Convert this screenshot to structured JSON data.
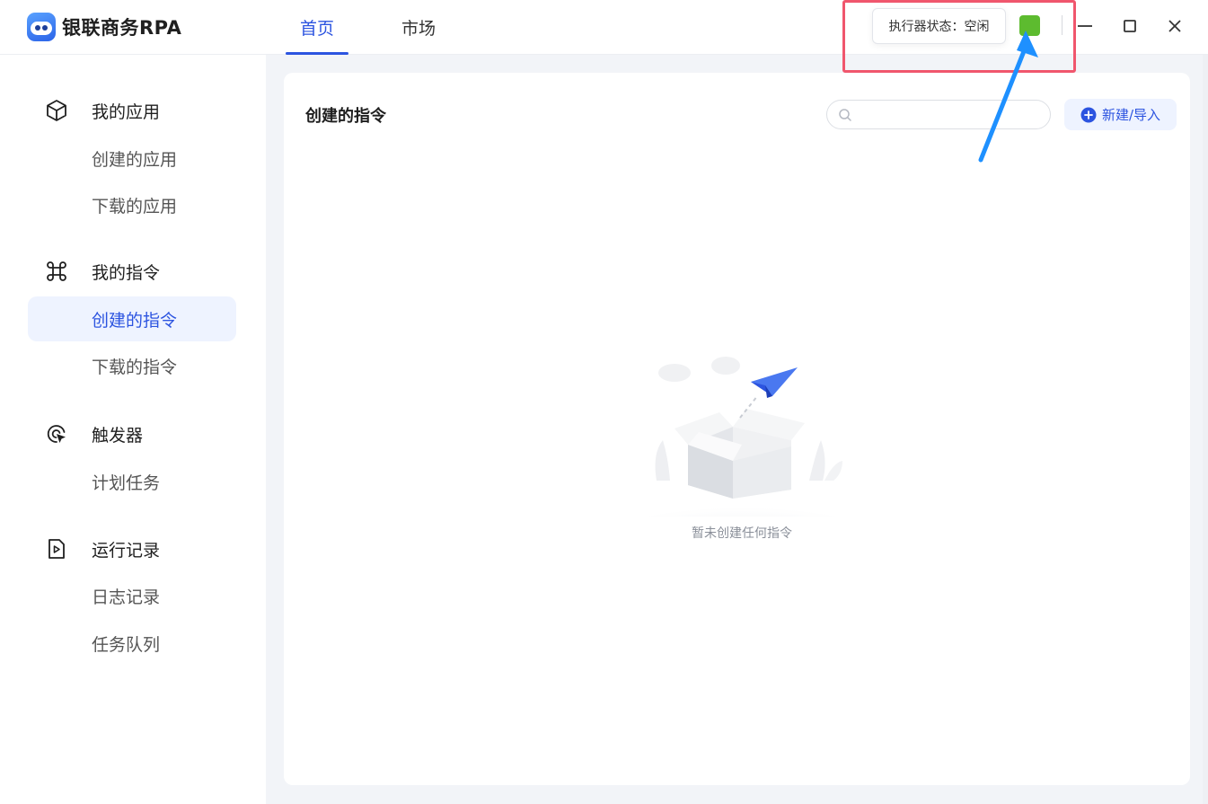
{
  "app": {
    "name": "银联商务RPA"
  },
  "nav": {
    "tabs": [
      {
        "label": "首页",
        "active": true
      },
      {
        "label": "市场",
        "active": false
      }
    ]
  },
  "executor": {
    "tooltip": "执行器状态：空闲",
    "status_color": "#5dbb2f"
  },
  "window_controls": [
    "minimize-icon",
    "maximize-icon",
    "close-icon"
  ],
  "sidebar": {
    "groups": [
      {
        "title": "我的应用",
        "icon": "cube-icon",
        "items": [
          {
            "label": "创建的应用",
            "active": false
          },
          {
            "label": "下载的应用",
            "active": false
          }
        ]
      },
      {
        "title": "我的指令",
        "icon": "command-icon",
        "items": [
          {
            "label": "创建的指令",
            "active": true
          },
          {
            "label": "下载的指令",
            "active": false
          }
        ]
      },
      {
        "title": "触发器",
        "icon": "trigger-icon",
        "items": [
          {
            "label": "计划任务",
            "active": false
          }
        ]
      },
      {
        "title": "运行记录",
        "icon": "play-file-icon",
        "items": [
          {
            "label": "日志记录",
            "active": false
          },
          {
            "label": "任务队列",
            "active": false
          }
        ]
      }
    ]
  },
  "main": {
    "title": "创建的指令",
    "search": {
      "value": "",
      "placeholder": ""
    },
    "new_button": "新建/导入",
    "empty_text": "暂未创建任何指令"
  },
  "colors": {
    "accent": "#2c54e0",
    "active_bg": "#eef3ff",
    "annotation_box": "#f0566d",
    "annotation_arrow": "#1e90ff"
  }
}
